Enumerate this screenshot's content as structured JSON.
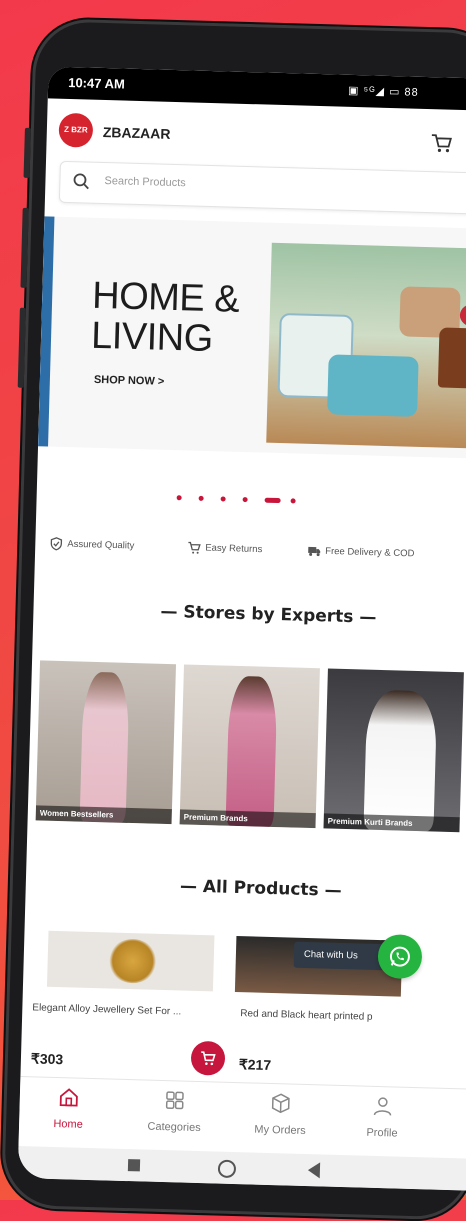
{
  "status_bar": {
    "time": "10:47 AM",
    "icons": "▣ ⁵ᴳ◢ ▭ 88"
  },
  "app": {
    "logo_text": "Z BZR",
    "brand": "ZBAZAAR"
  },
  "search": {
    "placeholder": "Search Products"
  },
  "banner": {
    "title_line1": "HOME &",
    "title_line2": "LIVING",
    "cta": "SHOP NOW >"
  },
  "carousel": {
    "count": 6,
    "active_index": 4
  },
  "features": [
    {
      "label": "Assured Quality",
      "icon": "shield-check-icon"
    },
    {
      "label": "Easy Returns",
      "icon": "cart-return-icon"
    },
    {
      "label": "Free Delivery & COD",
      "icon": "truck-icon"
    }
  ],
  "stores_section": {
    "title": "— Stores by Experts —"
  },
  "stores": [
    {
      "label": "Women Bestsellers"
    },
    {
      "label": "Premium Brands"
    },
    {
      "label": "Premium Kurti Brands"
    }
  ],
  "products_section": {
    "title": "— All Products —"
  },
  "products": [
    {
      "name": "Elegant Alloy Jewellery Set For ...",
      "price": "₹303"
    },
    {
      "name": "Red and Black heart printed p",
      "price": "₹217"
    }
  ],
  "chat": {
    "label": "Chat with Us"
  },
  "bottom_nav": [
    {
      "label": "Home",
      "icon": "home-icon",
      "active": true
    },
    {
      "label": "Categories",
      "icon": "grid-icon",
      "active": false
    },
    {
      "label": "My Orders",
      "icon": "box-icon",
      "active": false
    },
    {
      "label": "Profile",
      "icon": "user-icon",
      "active": false
    }
  ],
  "colors": {
    "brand": "#c7163d",
    "background": "#f2394c",
    "whatsapp": "#25b43f"
  }
}
